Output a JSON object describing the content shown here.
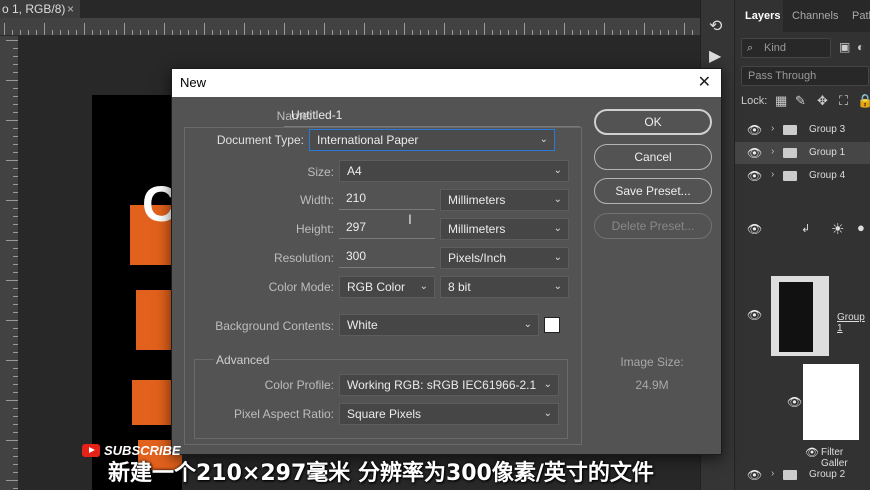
{
  "document_tab": {
    "title": "o 1, RGB/8)",
    "close": "×"
  },
  "canvas": {
    "letter": "C"
  },
  "layers_panel": {
    "tabs": [
      "Layers",
      "Channels",
      "Path"
    ],
    "kind_filter": "Kind",
    "blend_mode": "Pass Through",
    "lock_label": "Lock:",
    "layers": [
      {
        "name": "Group 3",
        "visible": true,
        "type": "group"
      },
      {
        "name": "Group 1",
        "visible": true,
        "type": "group",
        "selected": true
      },
      {
        "name": "Group 4",
        "visible": true,
        "type": "group"
      },
      {
        "name": "Group 1",
        "visible": true,
        "type": "smart"
      },
      {
        "name": "Filter Galler",
        "visible": true,
        "type": "filter"
      },
      {
        "name": "Group 2",
        "visible": true,
        "type": "group"
      }
    ]
  },
  "dialog": {
    "title": "New",
    "close": "✕",
    "name_label": "Name:",
    "name_value": "Untitled-1",
    "doc_type_label": "Document Type:",
    "doc_type_value": "International Paper",
    "size_label": "Size:",
    "size_value": "A4",
    "width_label": "Width:",
    "width_value": "210",
    "width_unit": "Millimeters",
    "height_label": "Height:",
    "height_value": "297",
    "height_unit": "Millimeters",
    "resolution_label": "Resolution:",
    "resolution_value": "300",
    "resolution_unit": "Pixels/Inch",
    "color_mode_label": "Color Mode:",
    "color_mode_value": "RGB Color",
    "bit_depth_value": "8 bit",
    "bg_contents_label": "Background Contents:",
    "bg_contents_value": "White",
    "advanced_label": "Advanced",
    "color_profile_label": "Color Profile:",
    "color_profile_value": "Working RGB:  sRGB IEC61966-2.1",
    "pixel_aspect_label": "Pixel Aspect Ratio:",
    "pixel_aspect_value": "Square Pixels",
    "buttons": {
      "ok": "OK",
      "cancel": "Cancel",
      "save_preset": "Save Preset...",
      "delete_preset": "Delete Preset..."
    },
    "image_size_label": "Image Size:",
    "image_size_value": "24.9M"
  },
  "overlay": {
    "subscribe": "SUBSCRIBE",
    "caption": "新建一个210×297毫米 分辨率为300像素/英寸的文件"
  },
  "colors": {
    "accent_orange": "#e2611c",
    "selection_blue": "#2b7ad8",
    "youtube_red": "#e62117"
  }
}
